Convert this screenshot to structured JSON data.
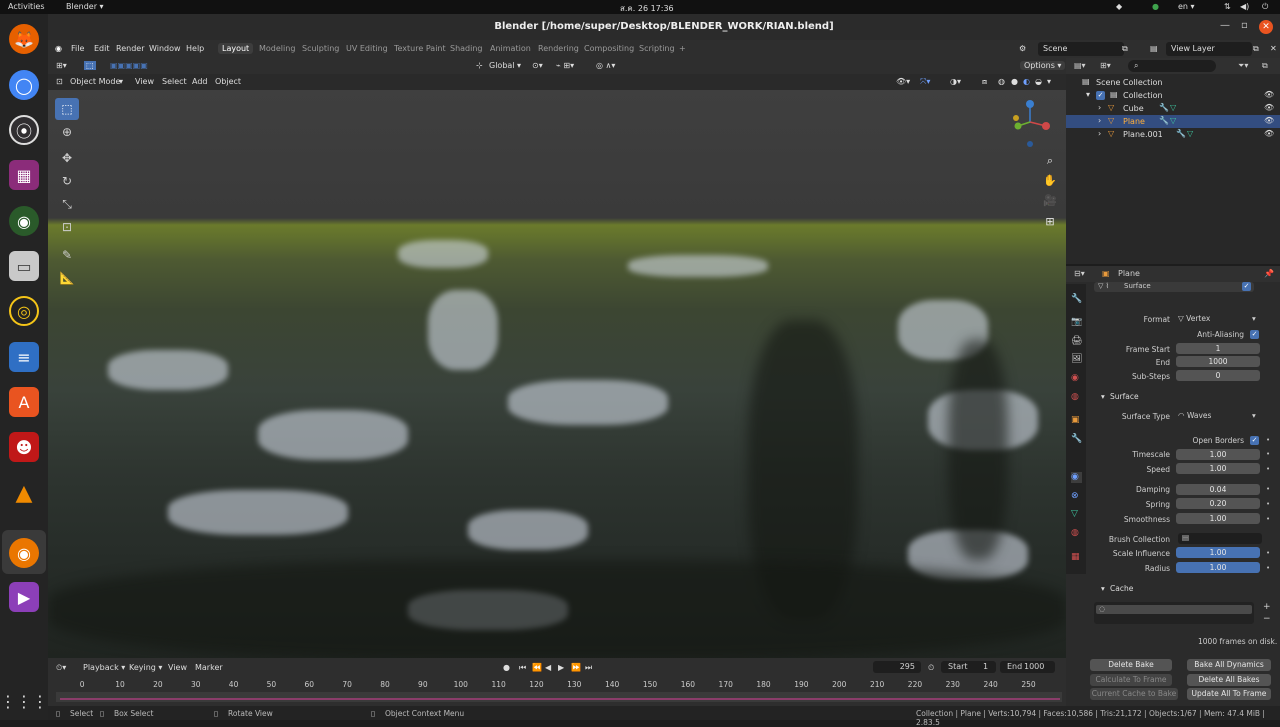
{
  "os": {
    "activities": "Activities",
    "app_menu": "Blender ▾",
    "clock": "ส.ค. 26  17:36",
    "language": "en ▾"
  },
  "window": {
    "title": "Blender [/home/super/Desktop/BLENDER_WORK/RIAN.blend]"
  },
  "menubar": {
    "items": [
      "File",
      "Edit",
      "Render",
      "Window",
      "Help"
    ],
    "workspaces": [
      "Layout",
      "Modeling",
      "Sculpting",
      "UV Editing",
      "Texture Paint",
      "Shading",
      "Animation",
      "Rendering",
      "Compositing",
      "Scripting"
    ],
    "active_workspace": "Layout",
    "scene": "Scene",
    "view_layer": "View Layer"
  },
  "viewport": {
    "transform_orientation": "Global",
    "options": "Options ▾",
    "mode": "Object Mode",
    "menu": [
      "View",
      "Select",
      "Add",
      "Object"
    ]
  },
  "outliner": {
    "root": "Scene Collection",
    "collection": "Collection",
    "objects": [
      "Cube",
      "Plane",
      "Plane.001"
    ],
    "selected": "Plane"
  },
  "properties": {
    "object": "Plane",
    "surface_header": "Surface",
    "format_label": "Format",
    "format_value": "Vertex",
    "anti_aliasing": "Anti-Aliasing",
    "frame_start_label": "Frame Start",
    "frame_start": "1",
    "end_label": "End",
    "end": "1000",
    "substeps_label": "Sub-Steps",
    "substeps": "0",
    "surface_section": "Surface",
    "surface_type_label": "Surface Type",
    "surface_type": "Waves",
    "open_borders": "Open Borders",
    "timescale_label": "Timescale",
    "timescale": "1.00",
    "speed_label": "Speed",
    "speed": "1.00",
    "damping_label": "Damping",
    "damping": "0.04",
    "spring_label": "Spring",
    "spring": "0.20",
    "smoothness_label": "Smoothness",
    "smoothness": "1.00",
    "brush_collection_label": "Brush Collection",
    "scale_influence_label": "Scale Influence",
    "scale_influence": "1.00",
    "radius_label": "Radius",
    "radius": "1.00",
    "cache_section": "Cache",
    "cache_info": "1000 frames on disk.",
    "delete_bake": "Delete Bake",
    "bake_all_dynamics": "Bake All Dynamics",
    "calculate_to_frame": "Calculate To Frame",
    "delete_all_bakes": "Delete All Bakes",
    "current_cache_to_bake": "Current Cache to Bake",
    "update_all_to_frame": "Update All To Frame"
  },
  "timeline": {
    "menu": [
      "Playback ▾",
      "Keying ▾",
      "View",
      "Marker"
    ],
    "current_frame": "295",
    "start_label": "Start",
    "start": "1",
    "end_label": "End",
    "end": "1000",
    "ticks": [
      "0",
      "10",
      "20",
      "30",
      "40",
      "50",
      "60",
      "70",
      "80",
      "90",
      "100",
      "110",
      "120",
      "130",
      "140",
      "150",
      "160",
      "170",
      "180",
      "190",
      "200",
      "210",
      "220",
      "230",
      "240",
      "250"
    ]
  },
  "statusbar": {
    "select": "Select",
    "box_select": "Box Select",
    "rotate_view": "Rotate View",
    "context_menu": "Object Context Menu",
    "stats": "Collection | Plane | Verts:10,794 | Faces:10,586 | Tris:21,172 | Objects:1/67 | Mem: 47.4 MiB | 2.83.5"
  },
  "colors": {
    "accent": "#4772b3",
    "selection": "#334d80",
    "ubuntu_orange": "#e95420"
  }
}
